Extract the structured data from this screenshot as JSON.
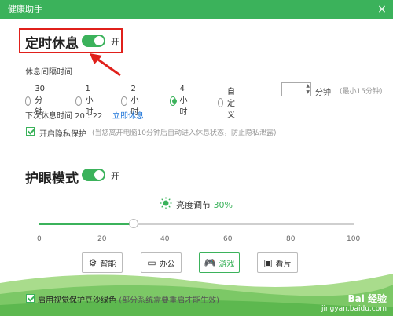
{
  "window": {
    "title": "健康助手",
    "close_label": "×"
  },
  "rest": {
    "title": "定时休息",
    "toggle_state": "开",
    "interval_label": "休息间隔时间",
    "options": [
      "30分钟",
      "1小时",
      "2小时",
      "4小时",
      "自定义"
    ],
    "selected_option": "4小时",
    "custom_value": "",
    "custom_unit": "分钟",
    "custom_hint": "(最小15分钟)",
    "next_rest": "下次休息时间 20 : 22",
    "rest_now": "立即休息",
    "privacy_label": "开启隐私保护",
    "privacy_hint": "(当您离开电脑10分钟后自动进入休息状态，防止隐私泄露)",
    "privacy_checked": true
  },
  "eye": {
    "title": "护眼模式",
    "toggle_state": "开",
    "brightness_label": "亮度调节",
    "brightness_value": "30%",
    "brightness_level": 30,
    "ticks": [
      "0",
      "20",
      "40",
      "60",
      "80",
      "100"
    ],
    "modes": [
      {
        "label": "智能",
        "icon": "gear-icon"
      },
      {
        "label": "办公",
        "icon": "monitor-icon"
      },
      {
        "label": "游戏",
        "icon": "gamepad-icon"
      },
      {
        "label": "看片",
        "icon": "film-icon"
      }
    ],
    "active_mode": "游戏"
  },
  "footer": {
    "label": "启用视觉保护豆沙绿色",
    "hint": "(部分系统需要重启才能生效)",
    "checked": true
  },
  "watermark": {
    "line1": "Bai 经验",
    "line2": "jingyan.baidu.com"
  },
  "colors": {
    "accent": "#3bb25b",
    "highlight": "#e0201b",
    "link": "#1a73d9"
  }
}
